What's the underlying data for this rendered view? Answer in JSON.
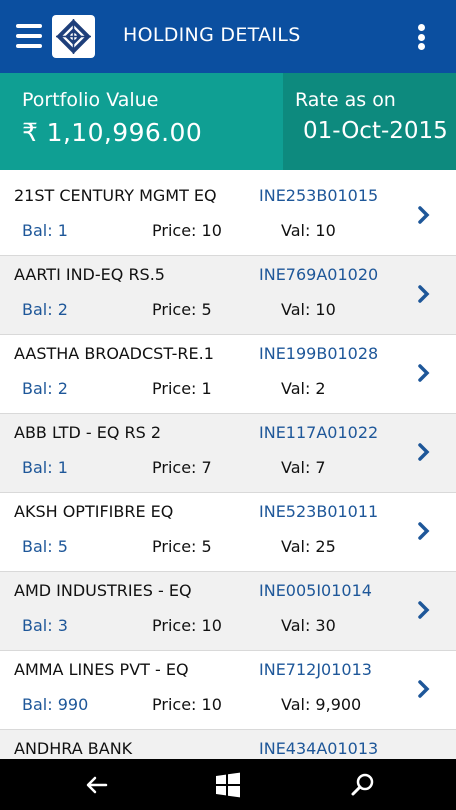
{
  "header": {
    "title": "HOLDING DETAILS"
  },
  "summary": {
    "portfolio_label": "Portfolio Value",
    "portfolio_value": "₹ 1,10,996.00",
    "rate_label": "Rate as on",
    "rate_value": "01-Oct-2015"
  },
  "holdings": [
    {
      "name": "21ST CENTURY MGMT EQ",
      "isin": "INE253B01015",
      "bal": "Bal: 1",
      "price": "Price: 10",
      "val": "Val: 10"
    },
    {
      "name": "AARTI IND-EQ RS.5",
      "isin": "INE769A01020",
      "bal": "Bal: 2",
      "price": "Price: 5",
      "val": "Val: 10"
    },
    {
      "name": "AASTHA BROADCST-RE.1",
      "isin": "INE199B01028",
      "bal": "Bal: 2",
      "price": "Price: 1",
      "val": "Val: 2"
    },
    {
      "name": "ABB LTD - EQ RS 2",
      "isin": "INE117A01022",
      "bal": "Bal: 1",
      "price": "Price: 7",
      "val": "Val: 7"
    },
    {
      "name": "AKSH OPTIFIBRE EQ",
      "isin": "INE523B01011",
      "bal": "Bal: 5",
      "price": "Price: 5",
      "val": "Val: 25"
    },
    {
      "name": "AMD INDUSTRIES - EQ",
      "isin": "INE005I01014",
      "bal": "Bal: 3",
      "price": "Price: 10",
      "val": "Val: 30"
    },
    {
      "name": "AMMA LINES PVT - EQ",
      "isin": "INE712J01013",
      "bal": "Bal: 990",
      "price": "Price: 10",
      "val": "Val: 9,900"
    },
    {
      "name": "ANDHRA BANK",
      "isin": "INE434A01013",
      "bal": "",
      "price": "",
      "val": ""
    }
  ],
  "colors": {
    "header": "#0b4fa0",
    "portfolio": "#0f9f93",
    "rate": "#0d8a7e",
    "accent": "#1e5799"
  },
  "icons": [
    "menu-icon",
    "app-logo",
    "more-options-icon",
    "chevron-right-icon",
    "back-icon",
    "windows-icon",
    "search-icon"
  ]
}
